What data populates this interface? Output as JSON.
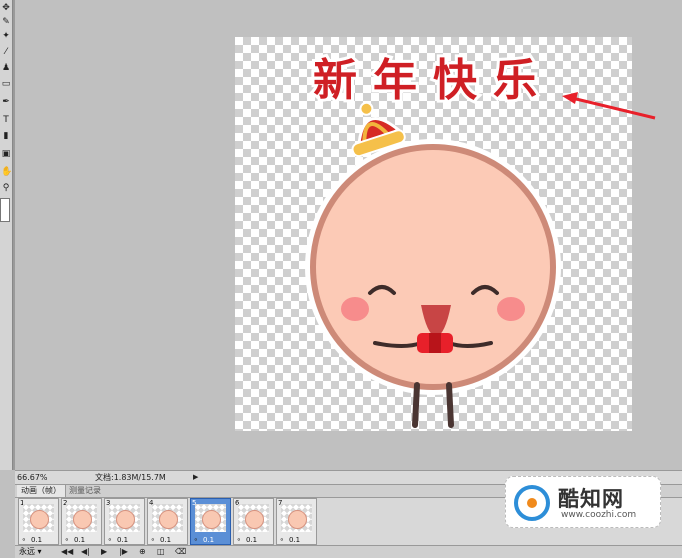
{
  "toolbar": {
    "tools": [
      "move-icon",
      "marquee-icon",
      "lasso-icon",
      "wand-icon",
      "crop-icon",
      "slice-icon",
      "healing-icon",
      "brush-icon",
      "stamp-icon",
      "history-brush-icon",
      "eraser-icon",
      "gradient-icon",
      "blur-icon",
      "dodge-icon",
      "pen-icon",
      "type-icon",
      "path-select-icon",
      "shape-icon",
      "notes-icon",
      "eyedropper-icon",
      "hand-icon",
      "zoom-icon"
    ],
    "type_tool_label": "T"
  },
  "artwork": {
    "title": "新年快乐"
  },
  "status": {
    "zoom": "66.67%",
    "doc_info": "文档:1.83M/15.7M"
  },
  "panel": {
    "tabs": [
      "动画（帧）",
      "测量记录"
    ],
    "frames": [
      {
        "num": "1",
        "delay": "0.1",
        "selected": false
      },
      {
        "num": "2",
        "delay": "0.1",
        "selected": false
      },
      {
        "num": "3",
        "delay": "0.1",
        "selected": false
      },
      {
        "num": "4",
        "delay": "0.1",
        "selected": false
      },
      {
        "num": "5",
        "delay": "0.1",
        "selected": true
      },
      {
        "num": "6",
        "delay": "0.1",
        "selected": false
      },
      {
        "num": "7",
        "delay": "0.1",
        "selected": false
      }
    ],
    "loop": "永远 ▾",
    "controls": [
      "◀◀",
      "◀|",
      "▶",
      "|▶",
      "⊕",
      "◫",
      "⌫"
    ]
  },
  "watermark": {
    "title": "酷知网",
    "url": "www.coozhi.com"
  },
  "colors": {
    "accent_arrow": "#e8202a",
    "frame_selected": "#5b8fd6",
    "title_red": "#cf1f24"
  }
}
